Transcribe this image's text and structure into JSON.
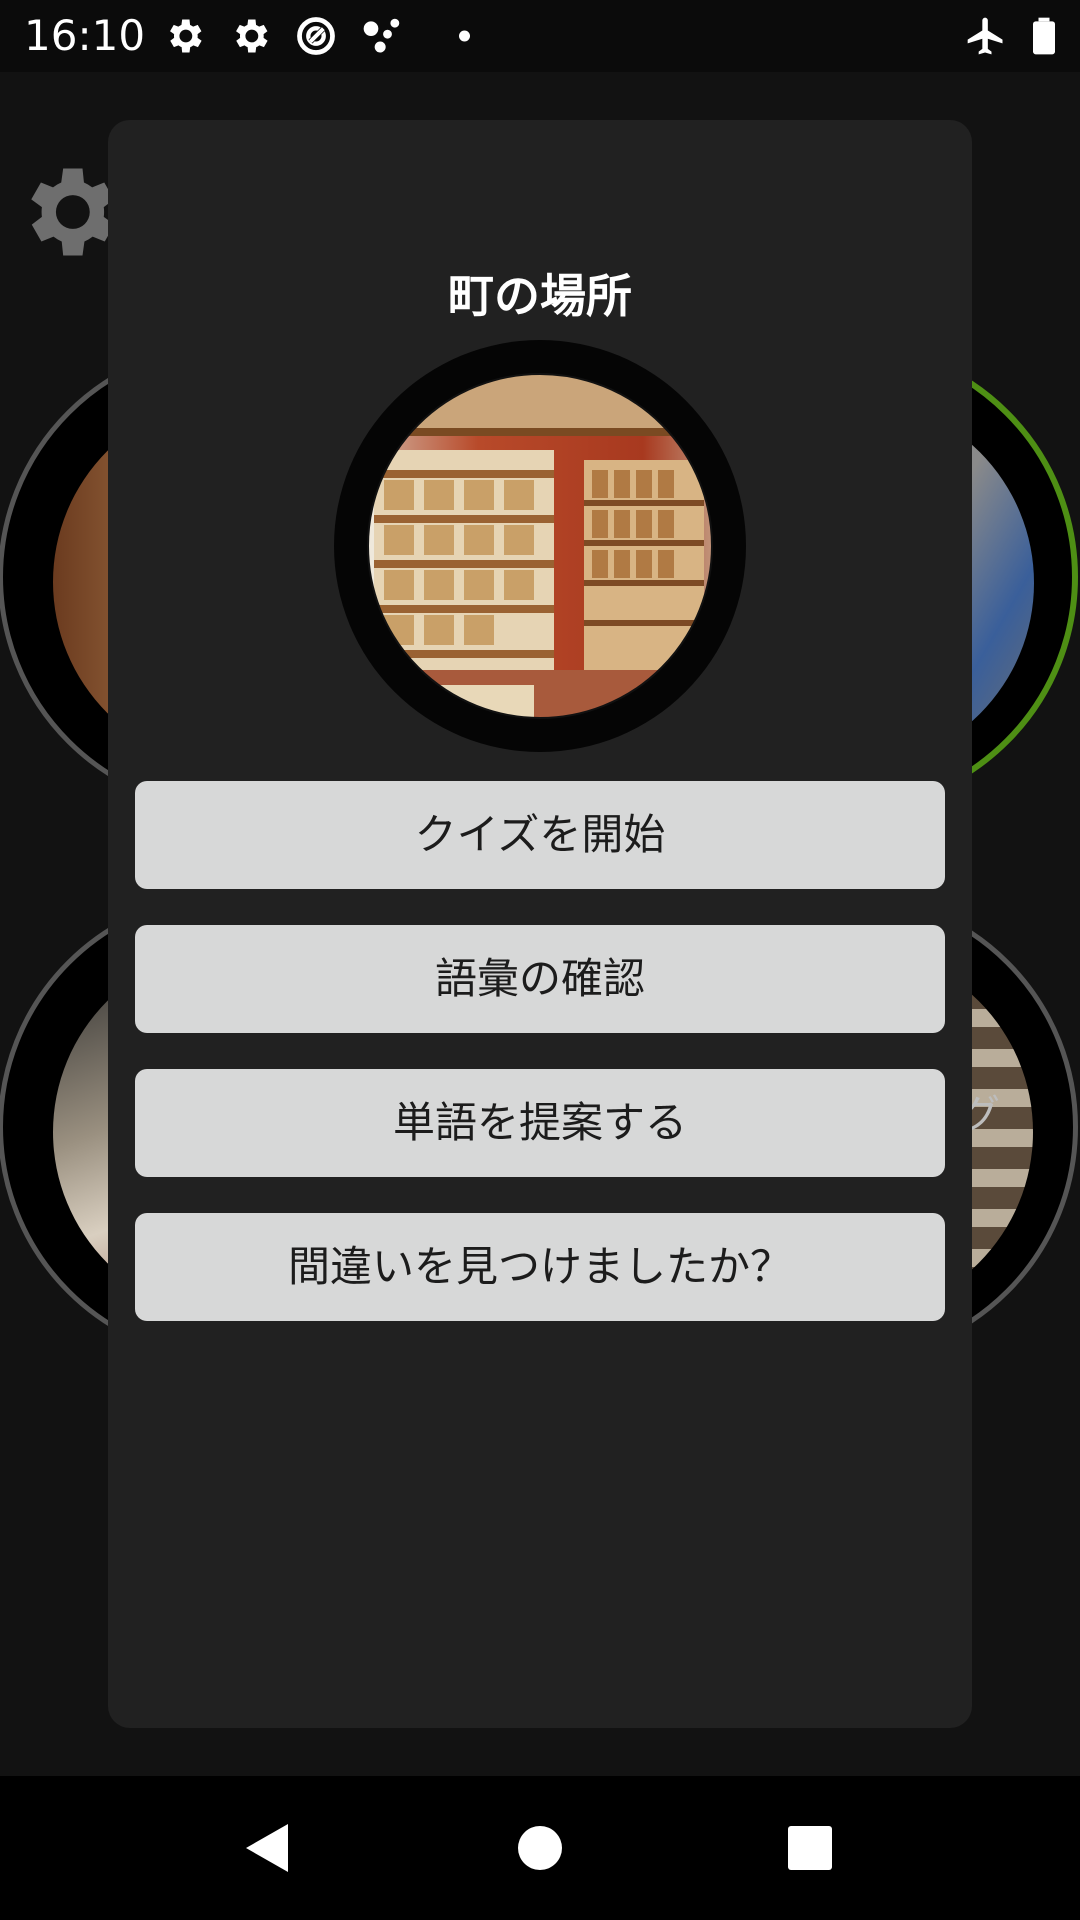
{
  "status_bar": {
    "time": "16:10",
    "left_icons": [
      "settings-icon",
      "settings-icon",
      "data-saver-icon",
      "assistant-dots-icon",
      "notification-dot-icon"
    ],
    "right_icons": [
      "airplane-mode-icon",
      "battery-icon"
    ]
  },
  "background_app": {
    "gear_icon": "gear-icon",
    "partial_label": "グ"
  },
  "dialog": {
    "title": "町の場所",
    "image_icon": "bakery-shelves-photo",
    "buttons": [
      {
        "label": "クイズを開始"
      },
      {
        "label": "語彙の確認"
      },
      {
        "label": "単語を提案する"
      },
      {
        "label": "間違いを見つけましたか？"
      }
    ]
  },
  "nav_bar": {
    "icons": [
      "back-icon",
      "home-icon",
      "recents-icon"
    ]
  },
  "colors": {
    "dialog_bg": "#212121",
    "button_bg": "#d7d8d8",
    "accent_green": "#5d9c1a",
    "status_bar_bg": "#0b0b0b"
  }
}
